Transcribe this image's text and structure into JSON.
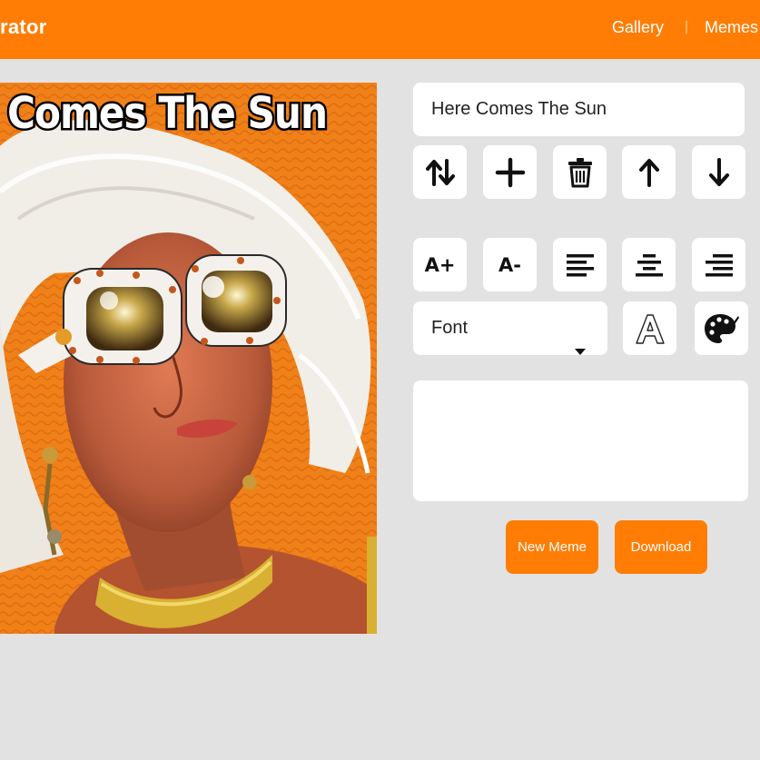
{
  "header": {
    "logo_text": "rator",
    "nav": [
      {
        "label": "Gallery"
      },
      {
        "label": "|"
      },
      {
        "label": "Memes"
      }
    ]
  },
  "meme": {
    "caption": "Comes The Sun",
    "image_subject": "woman-with-white-sunglasses-on-orange-background"
  },
  "editor": {
    "text_input_value": "Here Comes The Sun",
    "tools_row1": [
      {
        "icon": "swap-vertical-icon"
      },
      {
        "icon": "plus-icon"
      },
      {
        "icon": "trash-icon"
      },
      {
        "icon": "arrow-up-icon"
      },
      {
        "icon": "arrow-down-icon"
      }
    ],
    "tools_row2": [
      {
        "label": "A+",
        "icon": "increase-font-icon"
      },
      {
        "label": "A-",
        "icon": "decrease-font-icon"
      },
      {
        "icon": "align-left-icon"
      },
      {
        "icon": "align-center-icon"
      },
      {
        "icon": "align-right-icon"
      }
    ],
    "font_select_label": "Font",
    "stroke_icon": "outline-a-icon",
    "palette_icon": "palette-icon",
    "new_meme_label": "New Meme",
    "download_label": "Download"
  },
  "colors": {
    "accent": "#ff7d04",
    "background": "#e3e2e2",
    "panel": "#ffffff"
  }
}
